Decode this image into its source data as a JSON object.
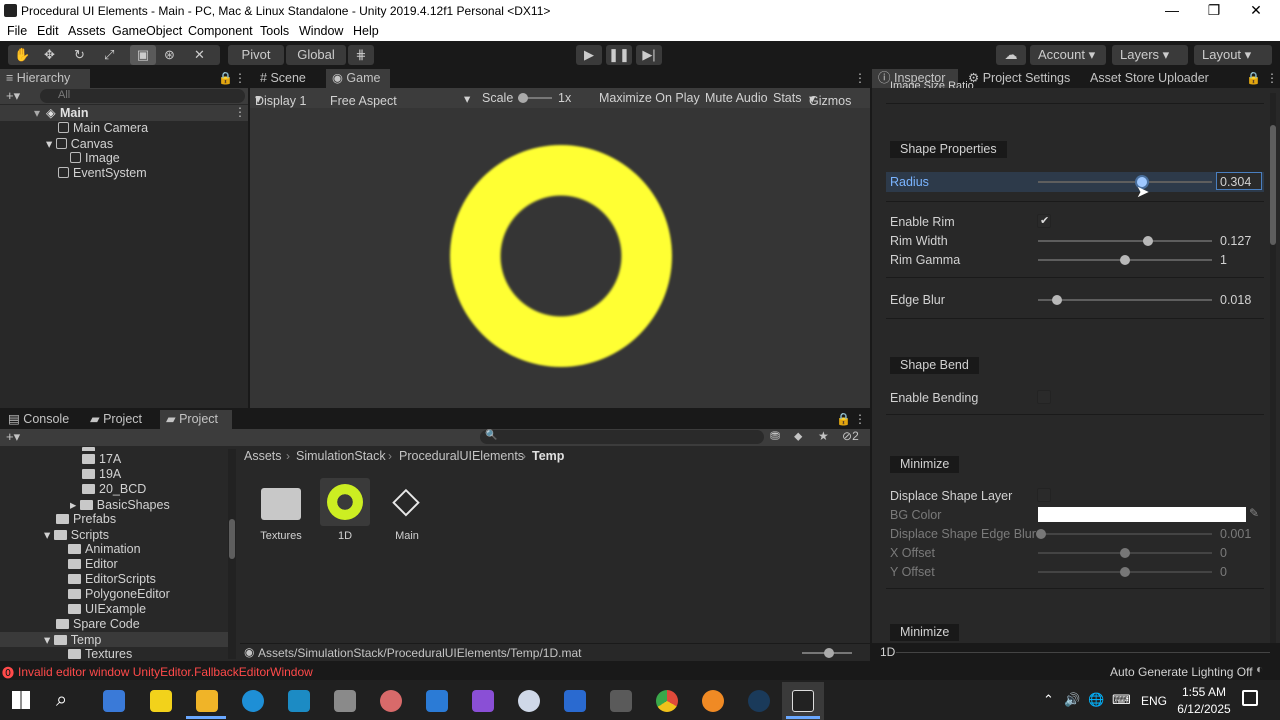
{
  "window": {
    "title": "Procedural UI Elements - Main - PC, Mac & Linux Standalone - Unity 2019.4.12f1 Personal <DX11>",
    "minimize": "—",
    "restore": "❐",
    "close": "✕"
  },
  "menu": [
    "File",
    "Edit",
    "Assets",
    "GameObject",
    "Component",
    "Tools",
    "Window",
    "Help"
  ],
  "toolbar": {
    "pivot": "Pivot",
    "global": "Global",
    "account": "Account",
    "layers": "Layers",
    "layout": "Layout"
  },
  "hierarchy": {
    "tab": "Hierarchy",
    "search_placeholder": "All",
    "scene": "Main",
    "items": [
      "Main Camera",
      "Canvas",
      "Image",
      "EventSystem"
    ]
  },
  "game": {
    "tab_scene": "Scene",
    "tab_game": "Game",
    "display": "Display 1",
    "aspect": "Free Aspect",
    "scale_label": "Scale",
    "scale_value": "1x",
    "maximize": "Maximize On Play",
    "mute": "Mute Audio",
    "stats": "Stats",
    "gizmos": "Gizmos",
    "ring_color": "#ffff33"
  },
  "inspector": {
    "tabs": [
      "Inspector",
      "Project Settings",
      "Asset Store Uploader"
    ],
    "clipped_label": "Image Size Ratio",
    "shape_props": "Shape Properties",
    "radius_label": "Radius",
    "radius_value": "0.304",
    "radius_fraction": 0.6,
    "enable_rim": "Enable Rim",
    "rim_check": "✔",
    "rim_width": "Rim Width",
    "rim_width_value": "0.127",
    "rim_width_fraction": 0.63,
    "rim_gamma": "Rim Gamma",
    "rim_gamma_value": "1",
    "rim_gamma_fraction": 0.5,
    "edge_blur": "Edge Blur",
    "edge_blur_value": "0.018",
    "edge_blur_fraction": 0.11,
    "shape_bend": "Shape Bend",
    "enable_bending": "Enable Bending",
    "minimize": "Minimize",
    "displace_layer": "Displace Shape Layer",
    "bg_color": "BG Color",
    "bg_color_hex": "#ffffff",
    "displace_edge_blur": "Displace Shape Edge Blur",
    "displace_edge_blur_value": "0.001",
    "displace_edge_blur_fraction": 0.02,
    "x_offset": "X Offset",
    "x_offset_value": "0",
    "y_offset": "Y Offset",
    "y_offset_value": "0",
    "offset_fraction": 0.5,
    "minimize2": "Minimize",
    "footer": "1D"
  },
  "project": {
    "tabs": [
      "Console",
      "Project",
      "Project"
    ],
    "hidden_count": "2",
    "tree": [
      "17A",
      "19A",
      "20_BCD",
      "BasicShapes",
      "Prefabs",
      "Scripts",
      "Animation",
      "Editor",
      "EditorScripts",
      "PolygoneEditor",
      "UIExample",
      "Spare Code",
      "Temp",
      "Textures"
    ],
    "breadcrumb": [
      "Assets",
      "SimulationStack",
      "ProceduralUIElements",
      "Temp"
    ],
    "assets": [
      "Textures",
      "1D",
      "Main"
    ],
    "path": "Assets/SimulationStack/ProceduralUIElements/Temp/1D.mat"
  },
  "status": {
    "error": "Invalid editor window UnityEditor.FallbackEditorWindow",
    "lighting": "Auto Generate Lighting Off"
  },
  "taskbar": {
    "lang": "ENG",
    "time": "1:55 AM",
    "date": "6/12/2025"
  }
}
